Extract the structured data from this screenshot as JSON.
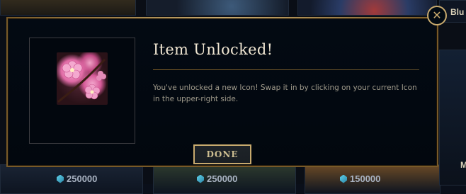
{
  "modal": {
    "title": "Item Unlocked!",
    "message": "You've unlocked a new Icon! Swap it in by clicking on your current Icon in the upper-right side.",
    "done_label": "DONE",
    "close_icon": "close-icon",
    "icon_name": "cherry-blossom-icon"
  },
  "background": {
    "tile_label_right_top": "Blu",
    "tile_label_right_bottom": "M",
    "prices": [
      "250000",
      "250000",
      "150000"
    ],
    "currency_icon": "blue-essence-icon"
  },
  "colors": {
    "gold_border": "#c8aa6e",
    "dark_gold": "#785a28",
    "title_text": "#f0e6d2",
    "body_text": "#a09b8c",
    "modal_bg": "#030a13"
  }
}
